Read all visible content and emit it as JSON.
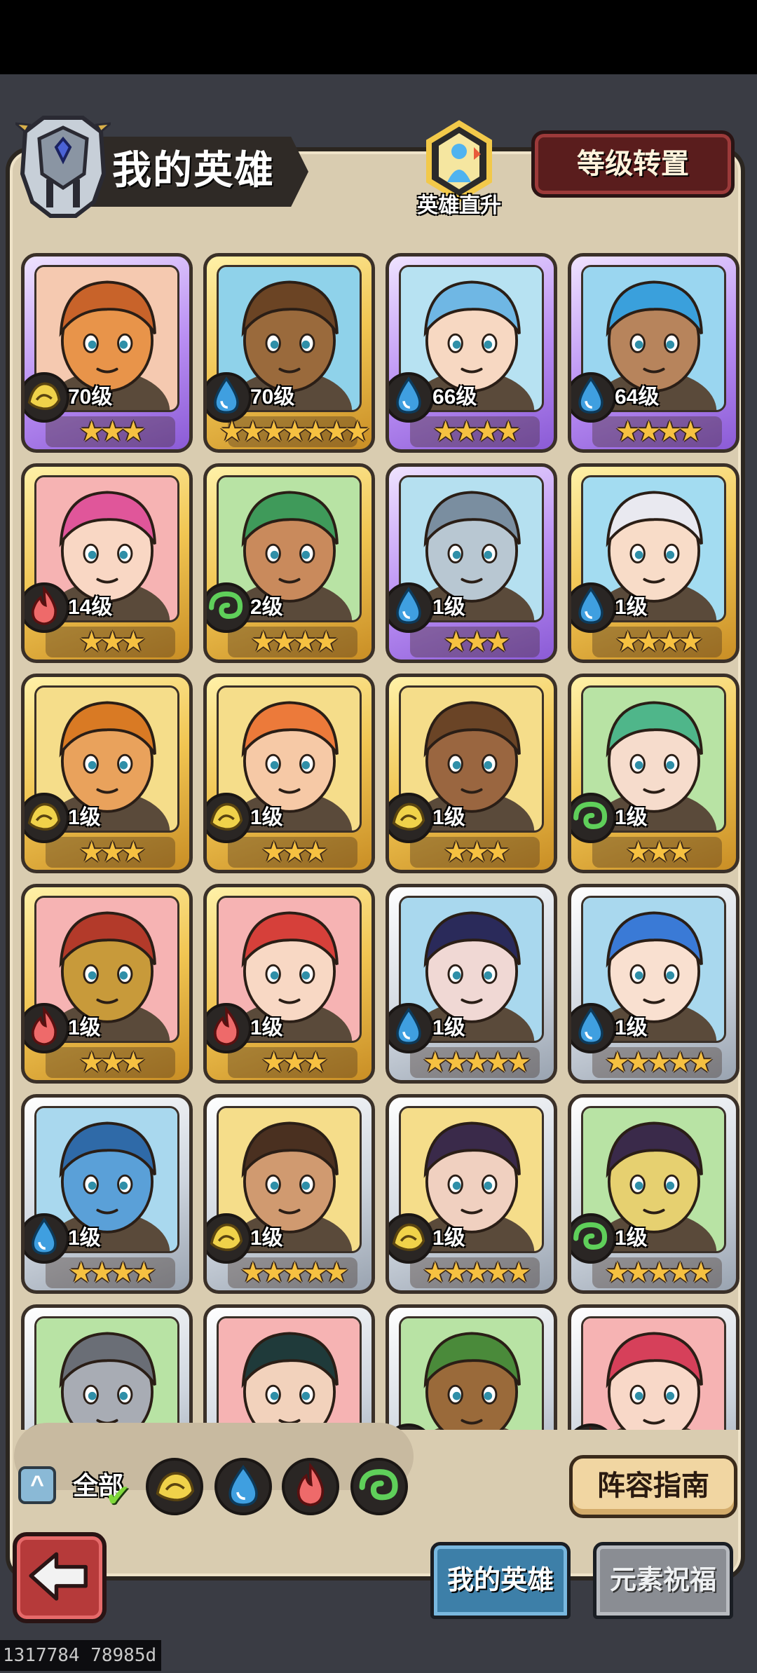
{
  "header": {
    "title": "我的英雄",
    "rise_label": "英雄直升",
    "transfer_label": "等级转置"
  },
  "heroes": [
    {
      "level": "70级",
      "element": "earth",
      "stars": "★★★",
      "frame": "purple",
      "skin": "#e8944a",
      "hair": "#c8632a",
      "bg": "#f5c9b0"
    },
    {
      "level": "70级",
      "element": "water",
      "stars": "★★★★★★★",
      "frame": "gold",
      "skin": "#9a6a3c",
      "hair": "#6b4424",
      "bg": "#8fd2ea"
    },
    {
      "level": "66级",
      "element": "water",
      "stars": "★★★★",
      "frame": "purple",
      "skin": "#f7d8c2",
      "hair": "#6fb7e4",
      "bg": "#b7e2f2"
    },
    {
      "level": "64级",
      "element": "water",
      "stars": "★★★★",
      "frame": "purple",
      "skin": "#b7845c",
      "hair": "#3aa0dc",
      "bg": "#9ad6f0"
    },
    {
      "level": "14级",
      "element": "fire",
      "stars": "★★★",
      "frame": "gold",
      "skin": "#f9d7c4",
      "hair": "#e0569a",
      "bg": "#f6b3b3"
    },
    {
      "level": "2级",
      "element": "wind",
      "stars": "★★★★",
      "frame": "gold",
      "skin": "#c98a5c",
      "hair": "#3f9a5a",
      "bg": "#b8e3a4"
    },
    {
      "level": "1级",
      "element": "water",
      "stars": "★★★",
      "frame": "purple",
      "skin": "#b8c7d2",
      "hair": "#7a8ea0",
      "bg": "#b5e0f0"
    },
    {
      "level": "1级",
      "element": "water",
      "stars": "★★★★",
      "frame": "gold",
      "skin": "#f8dcc8",
      "hair": "#e9e9f0",
      "bg": "#a3dcf1"
    },
    {
      "level": "1级",
      "element": "earth",
      "stars": "★★★",
      "frame": "gold",
      "skin": "#e9a25c",
      "hair": "#d97a24",
      "bg": "#f5dd8a"
    },
    {
      "level": "1级",
      "element": "earth",
      "stars": "★★★",
      "frame": "gold",
      "skin": "#f6c9a6",
      "hair": "#ec7a3a",
      "bg": "#f5dd8a"
    },
    {
      "level": "1级",
      "element": "earth",
      "stars": "★★★",
      "frame": "gold",
      "skin": "#9a6640",
      "hair": "#6a4426",
      "bg": "#f5dd8a"
    },
    {
      "level": "1级",
      "element": "wind",
      "stars": "★★★",
      "frame": "gold",
      "skin": "#f6dccc",
      "hair": "#4fb68a",
      "bg": "#b8e3a4"
    },
    {
      "level": "1级",
      "element": "fire",
      "stars": "★★★",
      "frame": "gold",
      "skin": "#c89a3a",
      "hair": "#b33a2a",
      "bg": "#f6b3b3"
    },
    {
      "level": "1级",
      "element": "fire",
      "stars": "★★★",
      "frame": "gold",
      "skin": "#f8d8c4",
      "hair": "#d6403a",
      "bg": "#f6b3b3"
    },
    {
      "level": "1级",
      "element": "water",
      "stars": "★★★★★",
      "frame": "silver",
      "skin": "#f0d8d4",
      "hair": "#2a2a5a",
      "bg": "#a9d8ee"
    },
    {
      "level": "1级",
      "element": "water",
      "stars": "★★★★★",
      "frame": "silver",
      "skin": "#f9e0d0",
      "hair": "#3a7ad6",
      "bg": "#a9d8ee"
    },
    {
      "level": "1级",
      "element": "water",
      "stars": "★★★★",
      "frame": "silver",
      "skin": "#5aa0d8",
      "hair": "#2f6aa8",
      "bg": "#a9d8ee"
    },
    {
      "level": "1级",
      "element": "earth",
      "stars": "★★★★★",
      "frame": "silver",
      "skin": "#d09a70",
      "hair": "#4a3020",
      "bg": "#f5dd8a"
    },
    {
      "level": "1级",
      "element": "earth",
      "stars": "★★★★★",
      "frame": "silver",
      "skin": "#f0d0c0",
      "hair": "#3a2a4a",
      "bg": "#f5dd8a"
    },
    {
      "level": "1级",
      "element": "wind",
      "stars": "★★★★★",
      "frame": "silver",
      "skin": "#e6d070",
      "hair": "#3a2a4a",
      "bg": "#b8e3a4"
    },
    {
      "level": "",
      "element": "wind",
      "stars": "",
      "frame": "silver",
      "skin": "#a8acb4",
      "hair": "#6a6e76",
      "bg": "#b8e3a4"
    },
    {
      "level": "",
      "element": "fire",
      "stars": "",
      "frame": "silver",
      "skin": "#f2d2bc",
      "hair": "#1f3a3a",
      "bg": "#f6b3b3"
    },
    {
      "level": "",
      "element": "wind",
      "stars": "",
      "frame": "silver",
      "skin": "#9a6a3a",
      "hair": "#4a8a3a",
      "bg": "#b8e3a4"
    },
    {
      "level": "",
      "element": "fire",
      "stars": "",
      "frame": "silver",
      "skin": "#f8d8c8",
      "hair": "#d6405a",
      "bg": "#f6b3b3"
    }
  ],
  "filters": {
    "all_label": "全部",
    "elements": [
      "earth",
      "water",
      "fire",
      "wind"
    ]
  },
  "buttons": {
    "guide_label": "阵容指南",
    "collapse_glyph": "^",
    "check_glyph": "✔"
  },
  "tabs": {
    "my_heroes": "我的英雄",
    "element_blessing": "元素祝福"
  },
  "footer": {
    "id_text": "1317784 78985d"
  },
  "colors": {
    "earth": "#f0d24a",
    "water": "#3f9fe0",
    "fire": "#ee6a6a",
    "wind": "#5fcf5a"
  }
}
